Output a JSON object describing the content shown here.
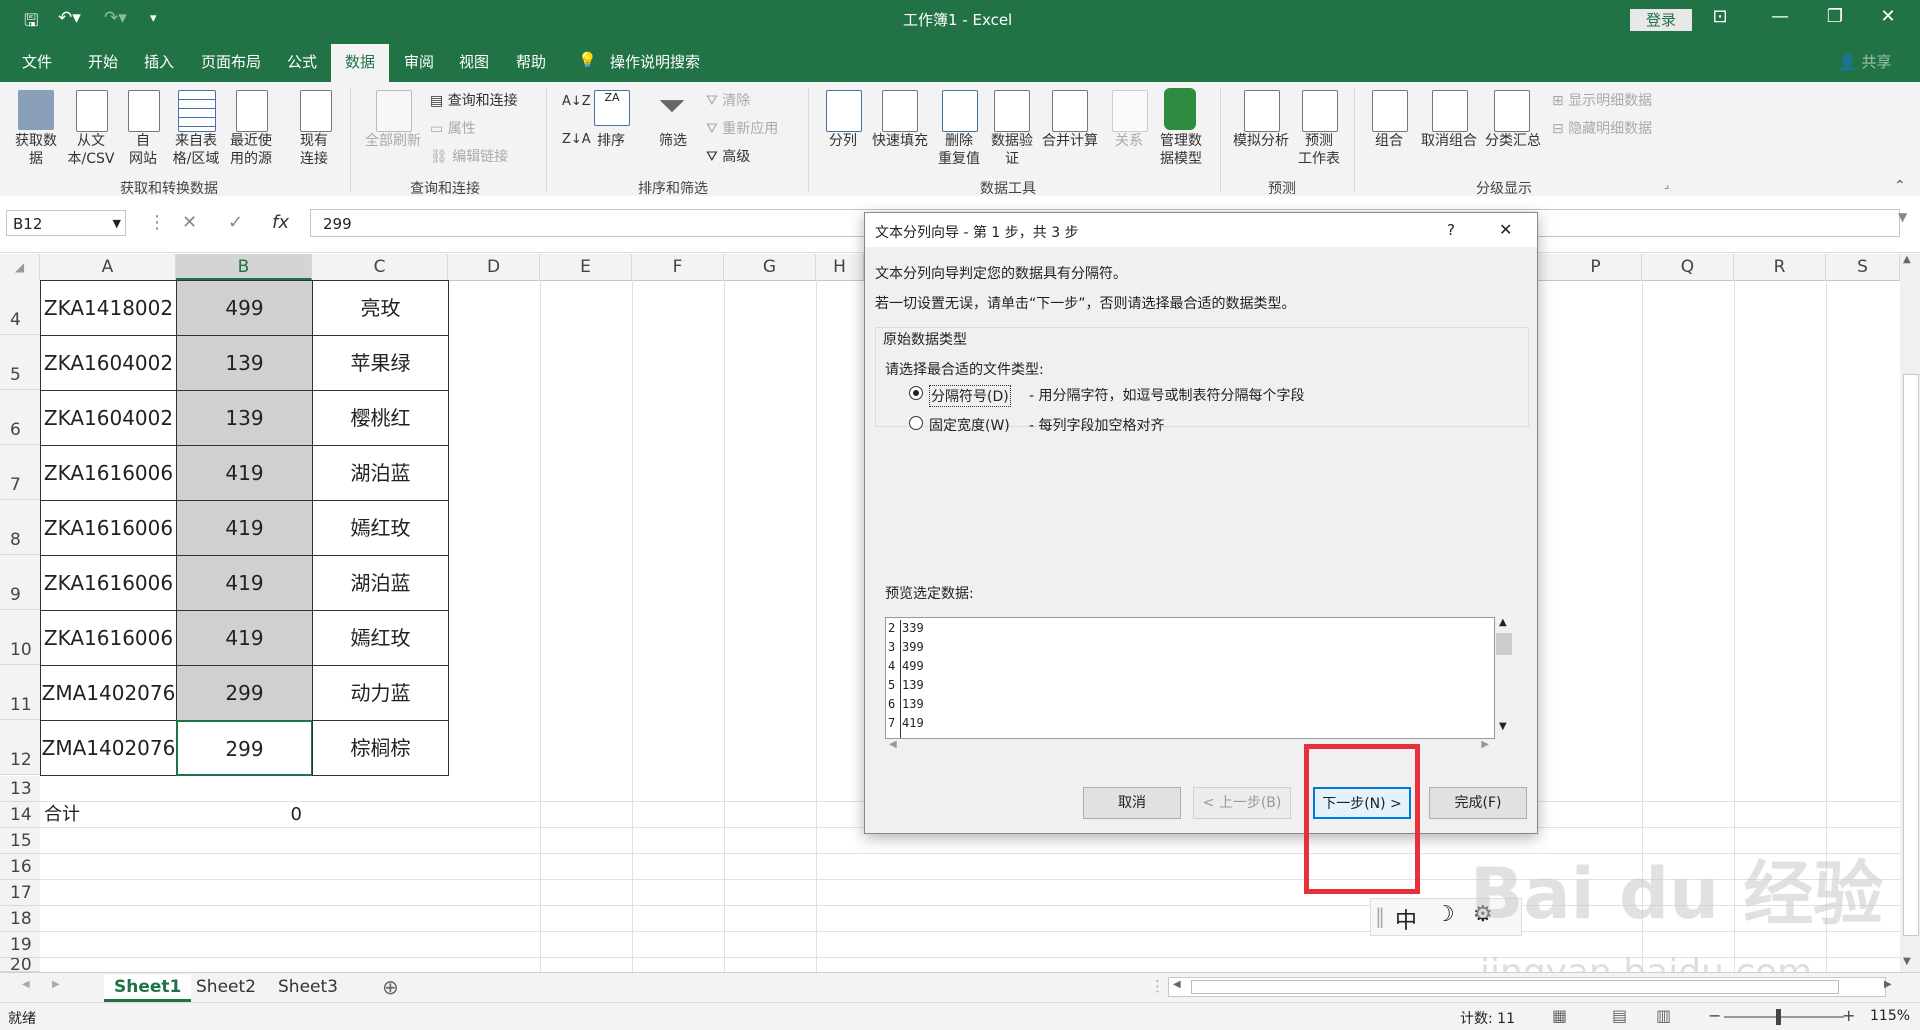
{
  "titlebar": {
    "doc_title": "工作簿1 - Excel",
    "login_label": "登录",
    "save_icon": "save-icon",
    "undo_icon": "undo-icon"
  },
  "tabs": [
    "文件",
    "开始",
    "插入",
    "页面布局",
    "公式",
    "数据",
    "审阅",
    "视图",
    "帮助"
  ],
  "active_tab": "数据",
  "tellme": "操作说明搜索",
  "share": "共享",
  "ribbon": {
    "get_data": "获取数\n据",
    "from_csv": "从文\n本/CSV",
    "from_web": "自\n网站",
    "from_table": "来自表\n格/区域",
    "recent_sources": "最近使\n用的源",
    "existing_conn": "现有\n连接",
    "refresh_all": "全部刷新",
    "queries_conn": "查询和连接",
    "properties": "属性",
    "edit_links": "编辑链接",
    "sort": "排序",
    "filter": "筛选",
    "clear": "清除",
    "reapply": "重新应用",
    "advanced": "高级",
    "text_to_cols": "分列",
    "flash_fill": "快速填充",
    "remove_dup": "删除\n重复值",
    "validation": "数据验\n证",
    "consolidate": "合并计算",
    "relations": "关系",
    "data_model": "管理数\n据模型",
    "whatif": "模拟分析",
    "forecast_sheet": "预测\n工作表",
    "group": "组合",
    "ungroup": "取消组合",
    "subtotal": "分类汇总",
    "show_detail": "显示明细数据",
    "hide_detail": "隐藏明细数据",
    "groups": {
      "get_transform": "获取和转换数据",
      "queries": "查询和连接",
      "sort_filter": "排序和筛选",
      "data_tools": "数据工具",
      "forecast": "预测",
      "outline": "分级显示"
    }
  },
  "formula_bar": {
    "name_box": "B12",
    "value": "299",
    "fx": "fx"
  },
  "columns": [
    "A",
    "B",
    "C",
    "D",
    "E",
    "F",
    "G",
    "H",
    "P",
    "Q",
    "R",
    "S"
  ],
  "rows": [
    {
      "num": "4",
      "a": "ZKA1418002",
      "b": "499",
      "c": "亮玫"
    },
    {
      "num": "5",
      "a": "ZKA1604002",
      "b": "139",
      "c": "苹果绿"
    },
    {
      "num": "6",
      "a": "ZKA1604002",
      "b": "139",
      "c": "樱桃红"
    },
    {
      "num": "7",
      "a": "ZKA1616006",
      "b": "419",
      "c": "湖泊蓝"
    },
    {
      "num": "8",
      "a": "ZKA1616006",
      "b": "419",
      "c": "嫣红玫"
    },
    {
      "num": "9",
      "a": "ZKA1616006",
      "b": "419",
      "c": "湖泊蓝"
    },
    {
      "num": "10",
      "a": "ZKA1616006",
      "b": "419",
      "c": "嫣红玫"
    },
    {
      "num": "11",
      "a": "ZMA1402076",
      "b": "299",
      "c": "动力蓝"
    },
    {
      "num": "12",
      "a": "ZMA1402076",
      "b": "299",
      "c": "棕榈棕"
    }
  ],
  "small_rows": [
    "13",
    "14",
    "15",
    "16",
    "17",
    "18",
    "19",
    "20"
  ],
  "total_label": "合计",
  "total_value": "0",
  "dialog": {
    "title": "文本分列向导 - 第 1 步，共 3 步",
    "help": "?",
    "close": "✕",
    "line1": "文本分列向导判定您的数据具有分隔符。",
    "line2": "若一切设置无误，请单击“下一步”，否则请选择最合适的数据类型。",
    "group_title": "原始数据类型",
    "choose_label": "请选择最合适的文件类型:",
    "opt1_label": "分隔符号(D)",
    "opt1_desc": "- 用分隔字符，如逗号或制表符分隔每个字段",
    "opt2_label": "固定宽度(W)",
    "opt2_desc": "- 每列字段加空格对齐",
    "preview_label": "预览选定数据:",
    "preview_lines": [
      {
        "n": "2",
        "v": "339"
      },
      {
        "n": "3",
        "v": "399"
      },
      {
        "n": "4",
        "v": "499"
      },
      {
        "n": "5",
        "v": "139"
      },
      {
        "n": "6",
        "v": "139"
      },
      {
        "n": "7",
        "v": "419"
      }
    ],
    "cancel": "取消",
    "back": "< 上一步(B)",
    "next": "下一步(N) >",
    "finish": "完成(F)"
  },
  "ime": {
    "mode": "中"
  },
  "watermark": {
    "brand": "Bai du 经验",
    "url": "jingyan.baidu.com"
  },
  "sheets": [
    "Sheet1",
    "Sheet2",
    "Sheet3"
  ],
  "status": {
    "ready": "就绪",
    "count": "计数: 11",
    "zoom": "115%"
  },
  "highlight_color": "#e8303a",
  "accent": "#217346"
}
